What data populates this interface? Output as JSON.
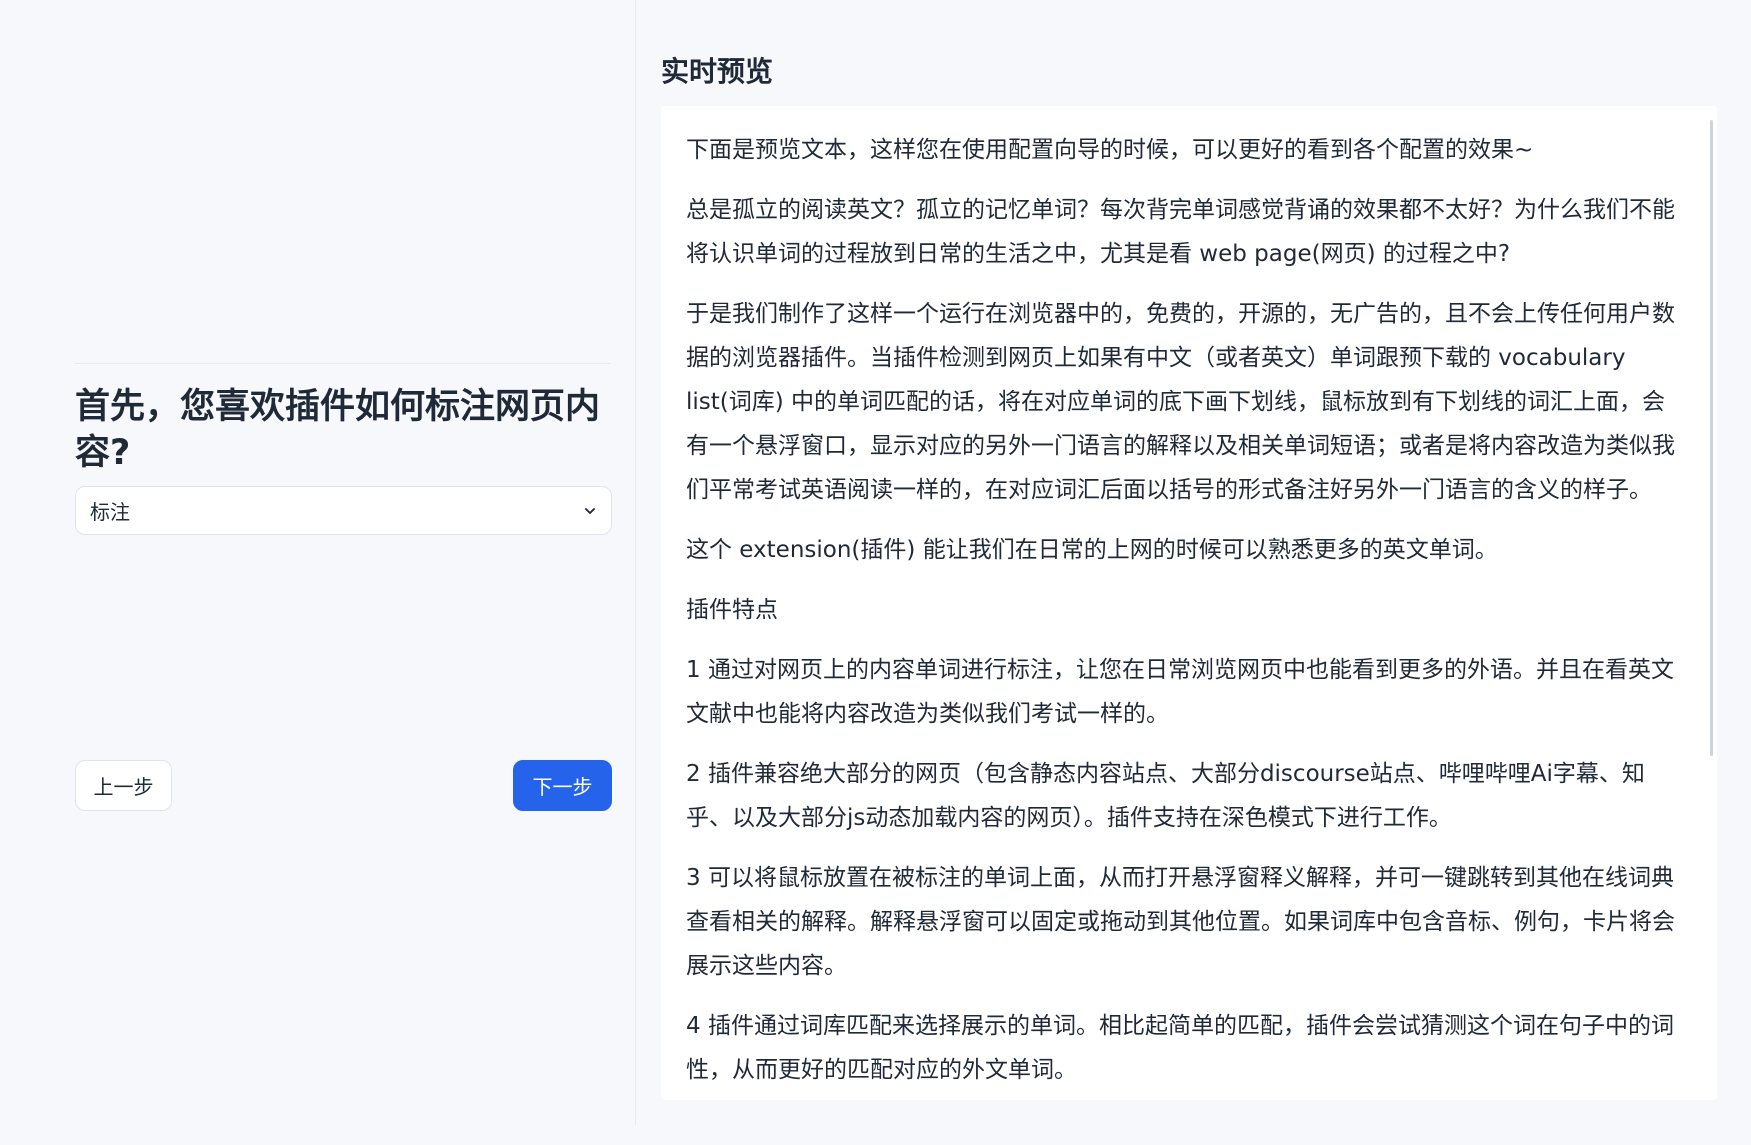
{
  "wizard": {
    "question": "首先，您喜欢插件如何标注网页内容?",
    "select": {
      "value": "标注"
    },
    "prev_label": "上一步",
    "next_label": "下一步"
  },
  "preview": {
    "title": "实时预览",
    "paragraphs": [
      "下面是预览文本，这样您在使用配置向导的时候，可以更好的看到各个配置的效果~",
      "总是孤立的阅读英文？孤立的记忆单词？每次背完单词感觉背诵的效果都不太好？为什么我们不能将认识单词的过程放到日常的生活之中，尤其是看 web page(网页) 的过程之中?",
      "于是我们制作了这样一个运行在浏览器中的，免费的，开源的，无广告的，且不会上传任何用户数据的浏览器插件。当插件检测到网页上如果有中文（或者英文）单词跟预下载的 vocabulary list(词库) 中的单词匹配的话，将在对应单词的底下画下划线，鼠标放到有下划线的词汇上面，会有一个悬浮窗口，显示对应的另外一门语言的解释以及相关单词短语；或者是将内容改造为类似我们平常考试英语阅读一样的，在对应词汇后面以括号的形式备注好另外一门语言的含义的样子。",
      "这个 extension(插件) 能让我们在日常的上网的时候可以熟悉更多的英文单词。",
      "插件特点",
      "1 通过对网页上的内容单词进行标注，让您在日常浏览网页中也能看到更多的外语。并且在看英文文献中也能将内容改造为类似我们考试一样的。",
      "2 插件兼容绝大部分的网页（包含静态内容站点、大部分discourse站点、哔哩哔哩Ai字幕、知乎、以及大部分js动态加载内容的网页）。插件支持在深色模式下进行工作。",
      "3 可以将鼠标放置在被标注的单词上面，从而打开悬浮窗释义解释，并可一键跳转到其他在线词典查看相关的解释。解释悬浮窗可以固定或拖动到其他位置。如果词库中包含音标、例句，卡片将会展示这些内容。",
      "4 插件通过词库匹配来选择展示的单词。相比起简单的匹配，插件会尝试猜测这个词在句子中的词性，从而更好的匹配对应的外文单词。"
    ]
  },
  "colors": {
    "primary": "#2563eb",
    "background": "#f6f8fb",
    "card": "#ffffff",
    "text": "#1f2937",
    "border": "#dfe3ea"
  },
  "icons": {
    "select_caret": "chevron-down-icon"
  }
}
